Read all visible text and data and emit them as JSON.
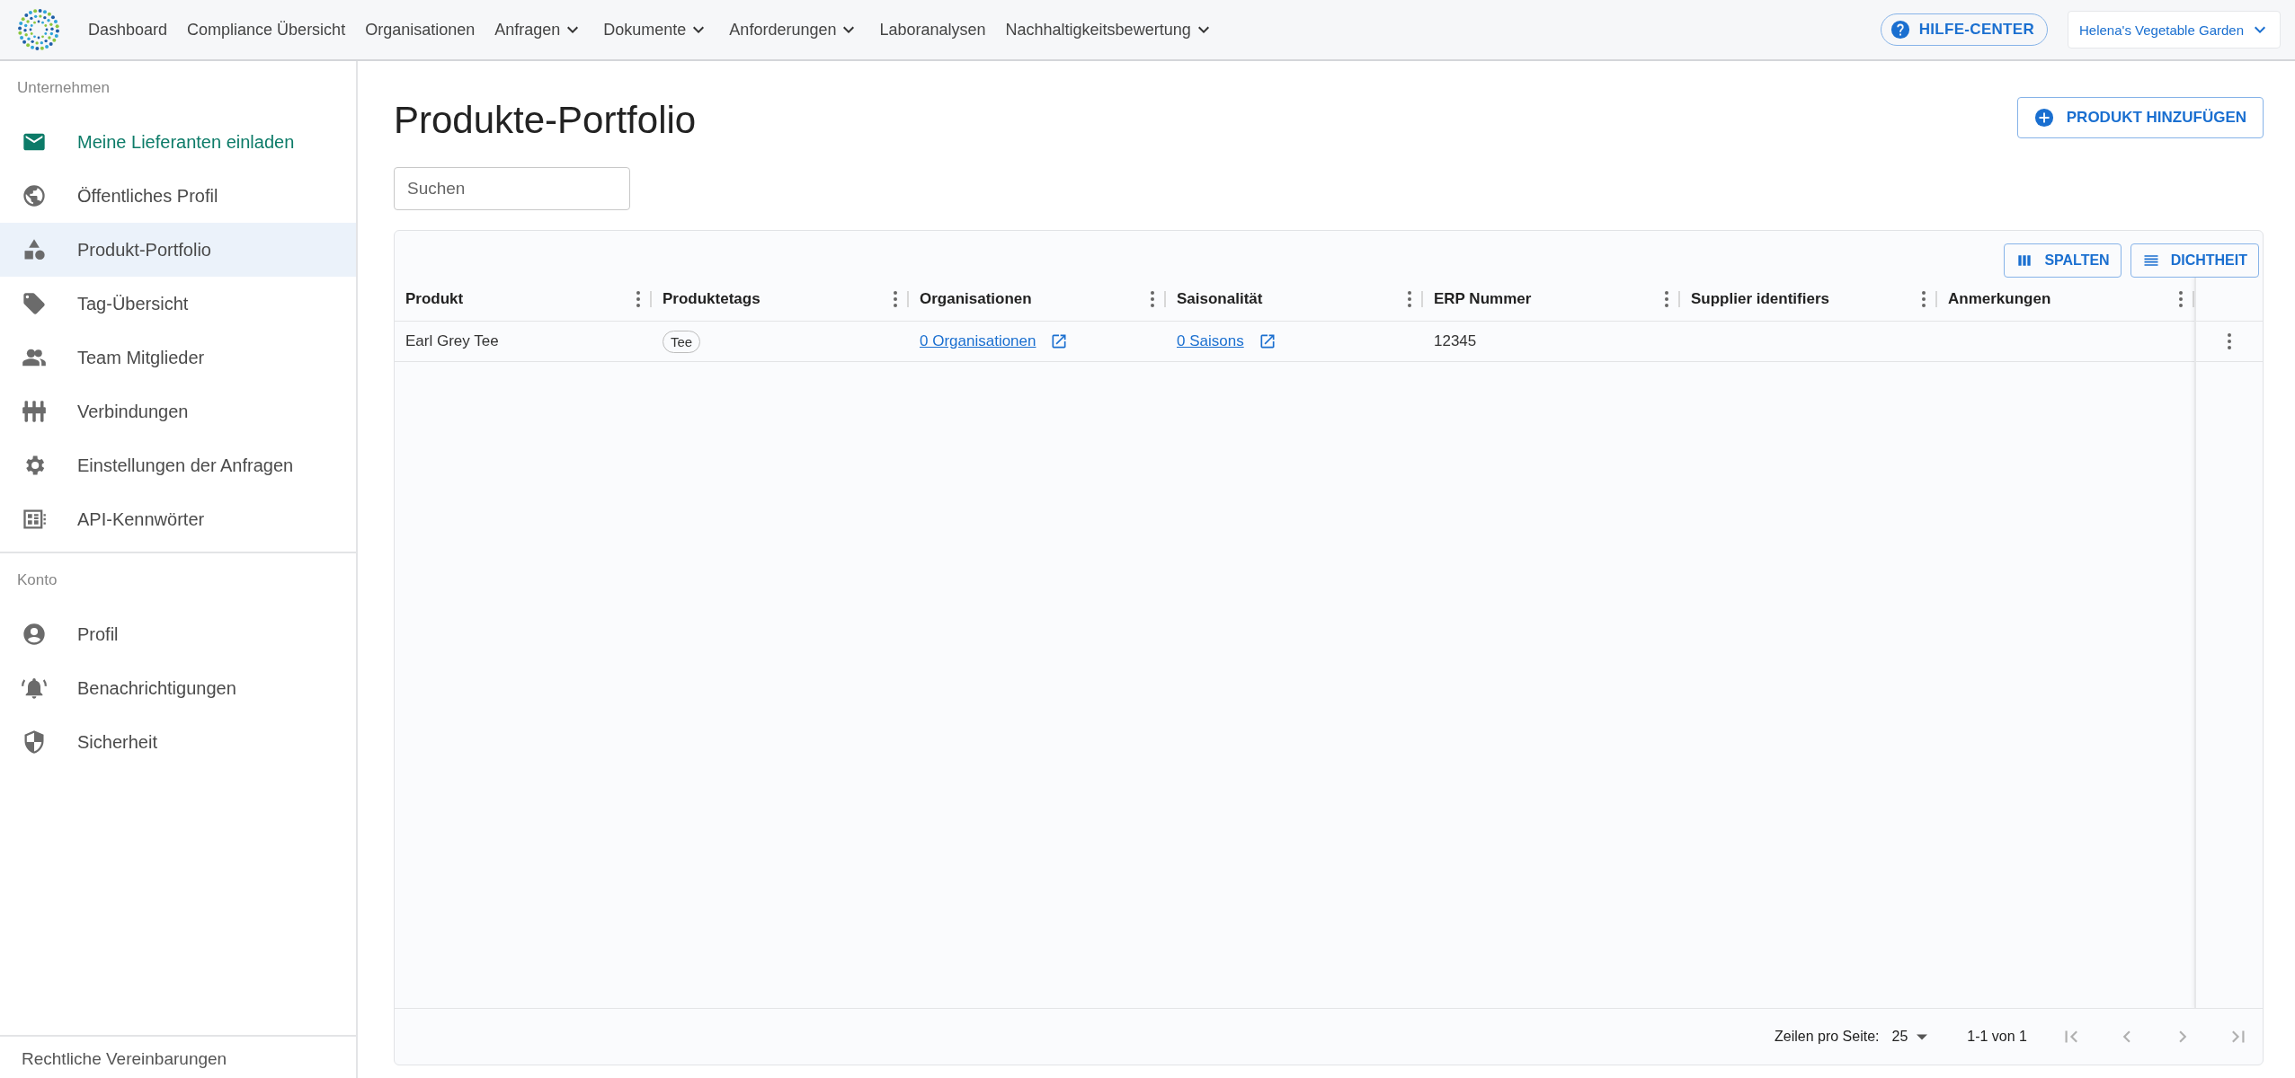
{
  "top_nav": {
    "items": [
      {
        "label": "Dashboard",
        "dropdown": false
      },
      {
        "label": "Compliance Übersicht",
        "dropdown": false
      },
      {
        "label": "Organisationen",
        "dropdown": false
      },
      {
        "label": "Anfragen",
        "dropdown": true
      },
      {
        "label": "Dokumente",
        "dropdown": true
      },
      {
        "label": "Anforderungen",
        "dropdown": true
      },
      {
        "label": "Laboranalysen",
        "dropdown": false
      },
      {
        "label": "Nachhaltigkeitsbewertung",
        "dropdown": true
      }
    ],
    "help_button": "HILFE-CENTER",
    "account": "Helena's Vegetable Garden"
  },
  "sidebar": {
    "sections": [
      {
        "heading": "Unternehmen",
        "items": [
          {
            "label": "Meine Lieferanten einladen",
            "selected": false,
            "accent": true
          },
          {
            "label": "Öffentliches Profil",
            "selected": false,
            "accent": false
          },
          {
            "label": "Produkt-Portfolio",
            "selected": true,
            "accent": false
          },
          {
            "label": "Tag-Übersicht",
            "selected": false,
            "accent": false
          },
          {
            "label": "Team Mitglieder",
            "selected": false,
            "accent": false
          },
          {
            "label": "Verbindungen",
            "selected": false,
            "accent": false
          },
          {
            "label": "Einstellungen der Anfragen",
            "selected": false,
            "accent": false
          },
          {
            "label": "API-Kennwörter",
            "selected": false,
            "accent": false
          }
        ]
      },
      {
        "heading": "Konto",
        "items": [
          {
            "label": "Profil",
            "selected": false,
            "accent": false
          },
          {
            "label": "Benachrichtigungen",
            "selected": false,
            "accent": false
          },
          {
            "label": "Sicherheit",
            "selected": false,
            "accent": false
          }
        ]
      }
    ],
    "footer_link": "Rechtliche Vereinbarungen"
  },
  "page": {
    "title": "Produkte-Portfolio",
    "add_button": "PRODUKT HINZUFÜGEN",
    "search": {
      "placeholder": "Suchen"
    }
  },
  "table": {
    "toolbar": [
      "SPALTEN",
      "DICHTHEIT"
    ],
    "columns": [
      "Produkt",
      "Produktetags",
      "Organisationen",
      "Saisonalität",
      "ERP Nummer",
      "Supplier identifiers",
      "Anmerkungen"
    ],
    "rows": [
      {
        "cells": [
          {
            "kind": "text",
            "text": "Earl Grey Tee"
          },
          {
            "kind": "tag",
            "text": "Tee"
          },
          {
            "kind": "link",
            "text": "0 Organisationen"
          },
          {
            "kind": "link",
            "text": "0 Saisons"
          },
          {
            "kind": "text",
            "text": "12345"
          }
        ]
      }
    ],
    "footer": {
      "rows_label": "Zeilen pro Seite:",
      "rows_value": "25",
      "range": "1-1 von 1",
      "pager_disabled": true
    }
  }
}
